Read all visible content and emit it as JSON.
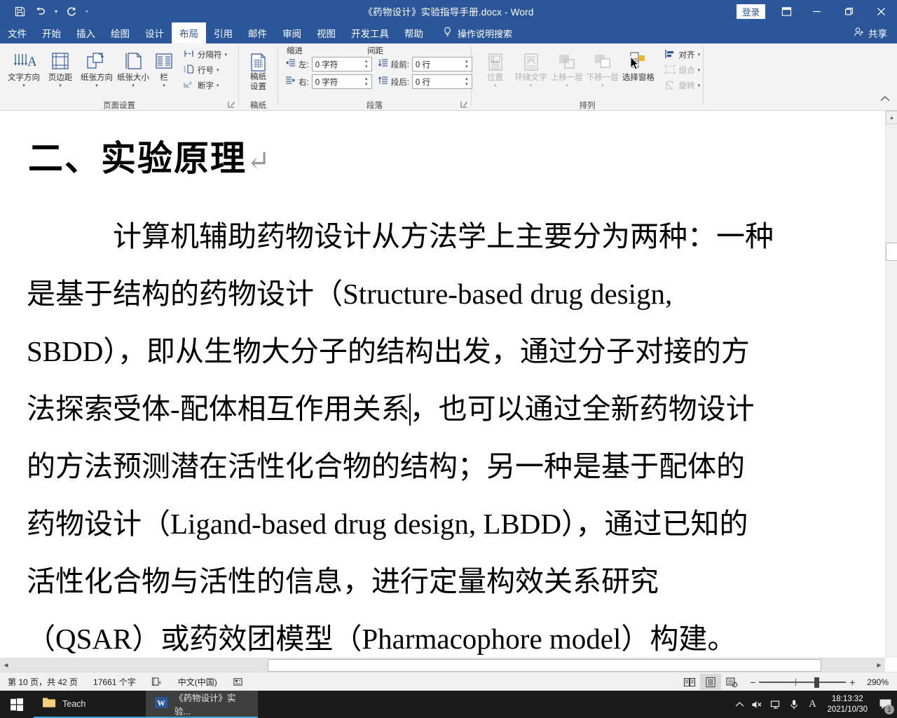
{
  "window": {
    "title": "《药物设计》实验指导手册.docx  -  Word",
    "signin_label": "登录",
    "minimize": "—",
    "restore": "❐",
    "close": "✕"
  },
  "quick_access": [
    {
      "name": "save-icon",
      "label": "保存"
    },
    {
      "name": "undo-icon",
      "label": "撤消"
    },
    {
      "name": "redo-icon",
      "label": "恢复"
    },
    {
      "name": "customize-qat-icon",
      "label": "自定义快速访问工具栏"
    }
  ],
  "tabs": [
    {
      "label": "文件",
      "active": false
    },
    {
      "label": "开始",
      "active": false
    },
    {
      "label": "插入",
      "active": false
    },
    {
      "label": "绘图",
      "active": false
    },
    {
      "label": "设计",
      "active": false
    },
    {
      "label": "布局",
      "active": true
    },
    {
      "label": "引用",
      "active": false
    },
    {
      "label": "邮件",
      "active": false
    },
    {
      "label": "审阅",
      "active": false
    },
    {
      "label": "视图",
      "active": false
    },
    {
      "label": "开发工具",
      "active": false
    },
    {
      "label": "帮助",
      "active": false
    }
  ],
  "tellme": {
    "placeholder": "操作说明搜索",
    "icon": "lightbulb-icon"
  },
  "share": {
    "label": "共享",
    "icon": "share-person-icon"
  },
  "ribbon": {
    "groups": [
      {
        "name": "页面设置",
        "label": "页面设置",
        "big_buttons": [
          {
            "label": "文字方向",
            "icon": "text-direction-icon",
            "has_chevron": true
          },
          {
            "label": "页边距",
            "icon": "margins-icon",
            "has_chevron": true
          },
          {
            "label": "纸张方向",
            "icon": "orientation-icon",
            "has_chevron": true
          },
          {
            "label": "纸张大小",
            "icon": "paper-size-icon",
            "has_chevron": true
          },
          {
            "label": "栏",
            "icon": "columns-icon",
            "has_chevron": true
          }
        ],
        "small_buttons": [
          {
            "label": "分隔符",
            "icon": "breaks-icon",
            "has_chevron": true
          },
          {
            "label": "行号",
            "icon": "line-numbers-icon",
            "has_chevron": true
          },
          {
            "label": "断字",
            "icon": "hyphenation-icon",
            "has_chevron": true
          }
        ]
      },
      {
        "name": "稿纸",
        "label": "稿纸",
        "big_buttons": [
          {
            "label_line1": "稿纸",
            "label_line2": "设置",
            "icon": "manuscript-paper-icon"
          }
        ]
      },
      {
        "name": "段落",
        "label": "段落",
        "col_headers": [
          "缩进",
          "间距"
        ],
        "fields": [
          {
            "label": "左:",
            "value": "0 字符",
            "icon": "indent-left-icon"
          },
          {
            "label": "右:",
            "value": "0 字符",
            "icon": "indent-right-icon"
          },
          {
            "label": "段前:",
            "value": "0 行",
            "icon": "space-before-icon"
          },
          {
            "label": "段后:",
            "value": "0 行",
            "icon": "space-after-icon"
          }
        ]
      },
      {
        "name": "排列",
        "label": "排列",
        "big_buttons": [
          {
            "label": "位置",
            "icon": "position-icon",
            "has_chevron": true,
            "disabled": true
          },
          {
            "label": "环绕文字",
            "icon": "wrap-text-icon",
            "has_chevron": true,
            "disabled": true
          },
          {
            "label": "上移一层",
            "icon": "bring-forward-icon",
            "has_chevron": true,
            "disabled": true
          },
          {
            "label": "下移一层",
            "icon": "send-backward-icon",
            "has_chevron": true,
            "disabled": true
          },
          {
            "label": "选择窗格",
            "icon": "selection-pane-icon",
            "has_chevron": false,
            "disabled": false
          }
        ],
        "small_buttons": [
          {
            "label": "对齐",
            "icon": "align-objects-icon",
            "has_chevron": true,
            "disabled": false
          },
          {
            "label": "组合",
            "icon": "group-objects-icon",
            "has_chevron": true,
            "disabled": true
          },
          {
            "label": "旋转",
            "icon": "rotate-objects-icon",
            "has_chevron": true,
            "disabled": true
          }
        ]
      }
    ],
    "collapse_label": "折叠功能区"
  },
  "document": {
    "heading": "二、实验原理",
    "paragraph_mark": "↵",
    "lines": [
      {
        "pre": "　　　计算机辅助药物设计从方法学上主要分为两种：一种",
        "caret": false,
        "post": ""
      },
      {
        "pre": "是基于结构的药物设计（Structure-based drug design,",
        "caret": false,
        "post": ""
      },
      {
        "pre": "SBDD），即从生物大分子的结构出发，通过分子对接的方",
        "caret": false,
        "post": ""
      },
      {
        "pre": "法探索受体-配体相互作用关系",
        "caret": true,
        "post": "，也可以通过全新药物设计"
      },
      {
        "pre": "的方法预测潜在活性化合物的结构；另一种是基于配体的",
        "caret": false,
        "post": ""
      },
      {
        "pre": "药物设计（Ligand-based drug design, LBDD），通过已知的",
        "caret": false,
        "post": ""
      },
      {
        "pre": "活性化合物与活性的信息，进行定量构效关系研究",
        "caret": false,
        "post": ""
      },
      {
        "pre": "（QSAR）或药效团模型（Pharmacophore model）构建。",
        "caret": false,
        "post": ""
      }
    ]
  },
  "statusbar": {
    "page_info": "第 10 页，共 42 页",
    "word_count": "17661 个字",
    "proofing_icon": "proofing-errors-icon",
    "language": "中文(中国)",
    "accessibility_icon": "accessibility-icon",
    "macro_icon": "record-macro-icon",
    "views": [
      {
        "name": "read-mode-view",
        "label": "阅读视图",
        "active": false
      },
      {
        "name": "print-layout-view",
        "label": "页面视图",
        "active": true
      },
      {
        "name": "web-layout-view",
        "label": "Web 版式视图",
        "active": false
      }
    ],
    "zoom_out": "−",
    "zoom_in": "+",
    "zoom_level": "290%"
  },
  "taskbar": {
    "start_label": "开始",
    "items": [
      {
        "label": "Teach",
        "icon": "folder-icon",
        "active": false
      },
      {
        "label": "《药物设计》实验...",
        "icon": "word-icon",
        "active": true
      }
    ],
    "tray": [
      {
        "name": "show-hidden-icons",
        "glyph": "⌃"
      },
      {
        "name": "volume-muted-icon",
        "glyph": "🔇"
      },
      {
        "name": "network-icon",
        "glyph": "🖧"
      },
      {
        "name": "microphone-icon",
        "glyph": "🎤"
      },
      {
        "name": "ime-input-icon",
        "glyph": "A"
      }
    ],
    "time": "18:13:32",
    "date": "2021/10/30",
    "notification_count": "1"
  },
  "colors": {
    "word_blue": "#2b579a",
    "ribbon_bg": "#f3f3f3",
    "taskbar_bg": "#1b1b1b",
    "accent_underline": "#3ba7e0"
  }
}
